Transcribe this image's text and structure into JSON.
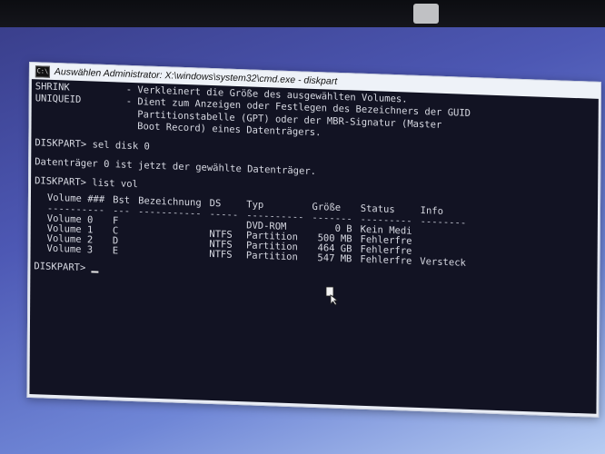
{
  "window": {
    "title": "Auswählen Administrator: X:\\windows\\system32\\cmd.exe - diskpart",
    "icon_glyph": "C:\\"
  },
  "help_lines": [
    {
      "cmd": "SHRINK",
      "desc": "- Verkleinert die Größe des ausgewählten Volumes."
    },
    {
      "cmd": "UNIQUEID",
      "desc": "- Dient zum Anzeigen oder Festlegen des Bezeichners der GUID"
    },
    {
      "cmd": "",
      "desc": "  Partitionstabelle (GPT) oder der MBR-Signatur (Master"
    },
    {
      "cmd": "",
      "desc": "  Boot Record) eines Datenträgers."
    }
  ],
  "commands": {
    "prompt1": "DISKPART> sel disk 0",
    "response1": "Datenträger 0 ist jetzt der gewählte Datenträger.",
    "prompt2": "DISKPART> list vol",
    "prompt3": "DISKPART>"
  },
  "volume_table": {
    "headers": [
      "Volume ###",
      "Bst",
      "Bezeichnung",
      "DS",
      "Typ",
      "Größe",
      "Status",
      "Info"
    ],
    "dashes": [
      "----------",
      "---",
      "-----------",
      "-----",
      "----------",
      "-------",
      "---------",
      "--------"
    ],
    "rows": [
      [
        "Volume 0",
        "F",
        "",
        "",
        "DVD-ROM",
        "0 B",
        "Kein Medi",
        ""
      ],
      [
        "Volume 1",
        "C",
        "",
        "NTFS",
        "Partition",
        "500 MB",
        "Fehlerfre",
        ""
      ],
      [
        "Volume 2",
        "D",
        "",
        "NTFS",
        "Partition",
        "464 GB",
        "Fehlerfre",
        ""
      ],
      [
        "Volume 3",
        "E",
        "",
        "NTFS",
        "Partition",
        "547 MB",
        "Fehlerfre",
        "Versteck"
      ]
    ]
  },
  "colors": {
    "console_bg": "#121323",
    "console_text": "#d7d9e2",
    "desktop": "#4d58b4"
  },
  "icons": {
    "cmd": "cmd-icon",
    "pointer": "mouse-pointer-icon"
  }
}
